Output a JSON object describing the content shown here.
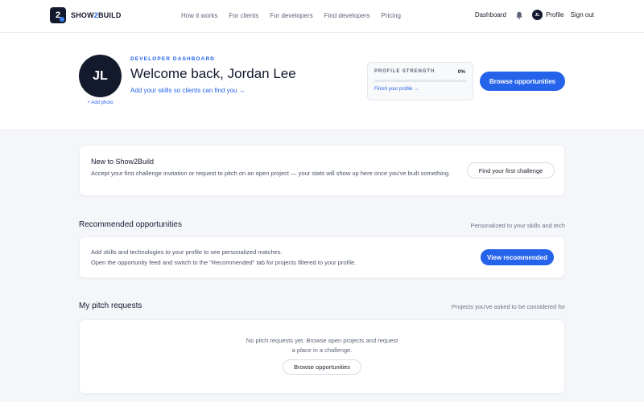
{
  "brand": {
    "prefix": "SHOW",
    "middle": "2",
    "suffix": "BUILD",
    "mark": "2"
  },
  "nav": {
    "links": [
      "How it works",
      "For clients",
      "For developers",
      "Find developers",
      "Pricing"
    ],
    "dashboard": "Dashboard",
    "avatar_initials": "JL",
    "profile": "Profile",
    "sign_out": "Sign out"
  },
  "hero": {
    "initials": "JL",
    "add_photo": "+ Add photo",
    "eyebrow": "DEVELOPER DASHBOARD",
    "welcome": "Welcome back, Jordan Lee",
    "sub_link": "Add your skills so clients can find you →",
    "strength": {
      "label": "PROFILE STRENGTH",
      "percent_text": "0%",
      "percent": 0,
      "finish_link": "Finish your profile →"
    },
    "browse_button": "Browse opportunities"
  },
  "new_card": {
    "title": "New to Show2Build",
    "description": "Accept your first challenge invitation or request to pitch on an open project — your stats will show up here once you've built something.",
    "button": "Find your first challenge"
  },
  "recommended": {
    "title": "Recommended opportunities",
    "note": "Personalized to your skills and tech",
    "line1": "Add skills and technologies to your profile to see personalized matches.",
    "line2": "Open the opportunity feed and switch to the \"Recommended\" tab for projects filtered to your profile.",
    "button": "View recommended"
  },
  "pitch": {
    "title": "My pitch requests",
    "note": "Projects you've asked to be considered for",
    "empty_line1": "No pitch requests yet. Browse open projects and request",
    "empty_line2": "a place in a challenge.",
    "button": "Browse opportunities"
  },
  "colors": {
    "accent": "#2563eb",
    "dark": "#141a2e"
  }
}
